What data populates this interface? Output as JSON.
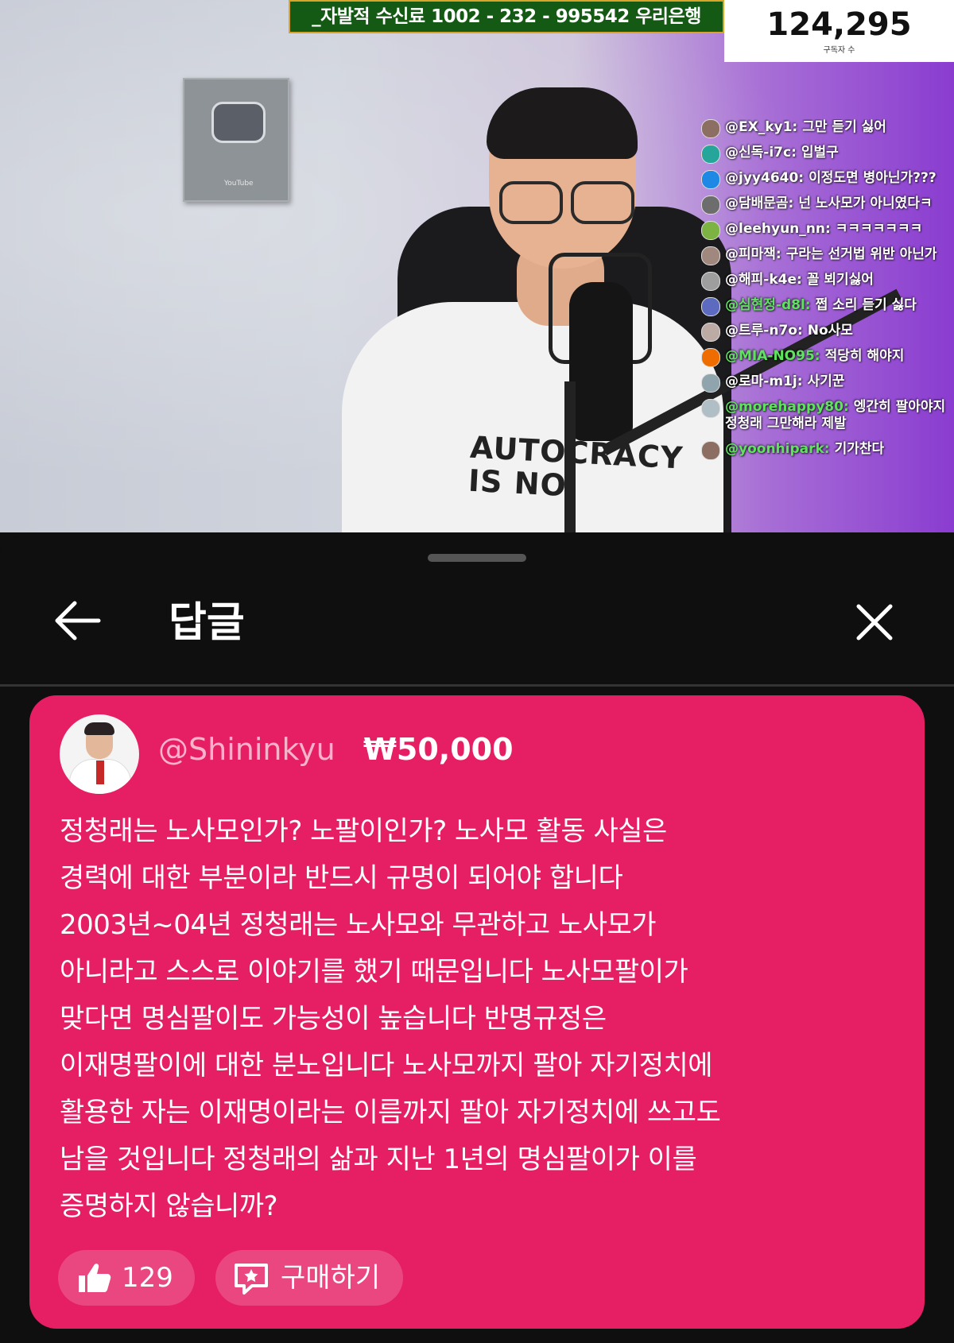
{
  "stream": {
    "donation_banner": "_자발적 수신료 1002 - 232 - 995542 우리은행",
    "subscriber_count": "124,295",
    "subscriber_label": "구독자 수",
    "shirt_text": "AUTOCRACY IS NO",
    "plaque_label": "YouTube",
    "chat": [
      {
        "user": "@EX_ky1:",
        "text": "그만 듣기 싫어",
        "green": false,
        "avatar_color": "#8d6e63"
      },
      {
        "user": "@신독-i7c:",
        "text": "입벌구",
        "green": false,
        "avatar_color": "#26a69a"
      },
      {
        "user": "@jyy4640:",
        "text": "이정도면 병아닌가???",
        "green": false,
        "avatar_color": "#1e88e5"
      },
      {
        "user": "@담배문곰:",
        "text": "넌 노사모가 아니였다ㅋ",
        "green": false,
        "avatar_color": "#6d6d6d"
      },
      {
        "user": "@leehyun_nn:",
        "text": "ㅋㅋㅋㅋㅋㅋㅋ",
        "green": false,
        "avatar_color": "#7cb342"
      },
      {
        "user": "@피마잭:",
        "text": "구라는 선거법 위반 아닌가",
        "green": false,
        "avatar_color": "#a1887f"
      },
      {
        "user": "@해피-k4e:",
        "text": "꼴 뵈기싫어",
        "green": false,
        "avatar_color": "#9e9e9e"
      },
      {
        "user": "@심현정-d8l:",
        "text": "쩝 소리 듣기 싫다",
        "green": true,
        "avatar_color": "#5c6bc0"
      },
      {
        "user": "@트루-n7o:",
        "text": "No사모",
        "green": false,
        "avatar_color": "#bcaaa4"
      },
      {
        "user": "@MIA-NO95:",
        "text": "적당히 해야지",
        "green": true,
        "avatar_color": "#ef6c00"
      },
      {
        "user": "@로마-m1j:",
        "text": "사기꾼",
        "green": false,
        "avatar_color": "#90a4ae"
      },
      {
        "user": "@morehappy80:",
        "text": "엥간히 팔아야지 정청래 그만해라 제발",
        "green": true,
        "avatar_color": "#b0bec5"
      },
      {
        "user": "@yoonhipark:",
        "text": "기가찬다",
        "green": true,
        "avatar_color": "#8d6e63"
      }
    ]
  },
  "panel": {
    "title": "답글",
    "back_icon": "arrow-left-icon",
    "close_icon": "close-icon"
  },
  "comment": {
    "username": "@Shininkyu",
    "amount": "₩50,000",
    "body": "정청래는 노사모인가? 노팔이인가? 노사모 활동 사실은\n경력에 대한 부분이라 반드시 규명이 되어야 합니다\n2003년~04년 정청래는 노사모와 무관하고 노사모가\n아니라고 스스로 이야기를 했기 때문입니다 노사모팔이가\n맞다면 명심팔이도 가능성이 높습니다 반명규정은\n이재명팔이에 대한 분노입니다 노사모까지 팔아 자기정치에\n활용한 자는 이재명이라는 이름까지 팔아 자기정치에 쓰고도\n남을 것입니다 정청래의 삶과 지난 1년의 명심팔이가 이를\n증명하지 않습니까?",
    "like_count": "129",
    "buy_label": "구매하기",
    "card_color": "#e61e63"
  }
}
